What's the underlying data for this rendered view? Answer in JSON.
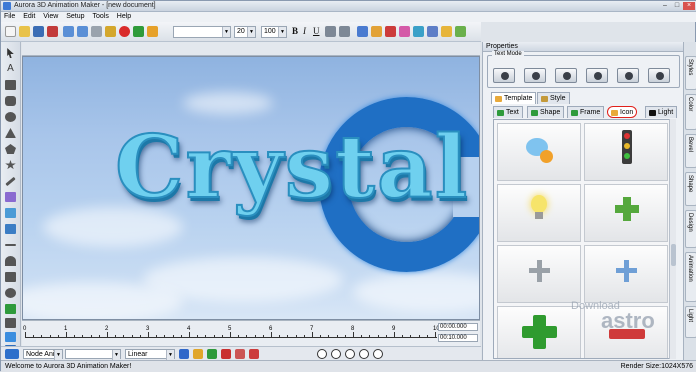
{
  "window": {
    "title": "Aurora 3D Animation Maker - [new document]"
  },
  "menu": [
    "File",
    "Edit",
    "View",
    "Setup",
    "Tools",
    "Help"
  ],
  "toolbar": {
    "font_size": "20",
    "zoom": "100",
    "bold": "B",
    "italic": "I",
    "underline": "U"
  },
  "timeline": {
    "ticks": [
      "0",
      "1",
      "2",
      "3",
      "4",
      "5",
      "6",
      "7",
      "8",
      "9",
      "10"
    ],
    "time_current": "00:00.000",
    "time_total": "00:10.000"
  },
  "bottombar": {
    "node_select": "Node Ani",
    "interp_select": "Linear"
  },
  "stage": {
    "text": "Crystal"
  },
  "panel": {
    "title": "Properties",
    "text_mode_label": "Text Mode",
    "tabs_top": [
      "Template",
      "Style"
    ],
    "tabs_sub": [
      "Text",
      "Shape",
      "Frame",
      "Icon",
      "Light"
    ],
    "active_sub": "Icon",
    "side_tabs": [
      "Styles",
      "Color",
      "Bevel",
      "Shape",
      "Design",
      "Animation",
      "Light"
    ]
  },
  "status": {
    "left": "Welcome to Aurora 3D Animation Maker!",
    "right": "Render Size:1024X576"
  },
  "watermark": {
    "line1": "Download",
    "line2": "astro"
  },
  "colors": {
    "accent": "#1f6fc4",
    "highlight_ring": "#e0201a"
  }
}
